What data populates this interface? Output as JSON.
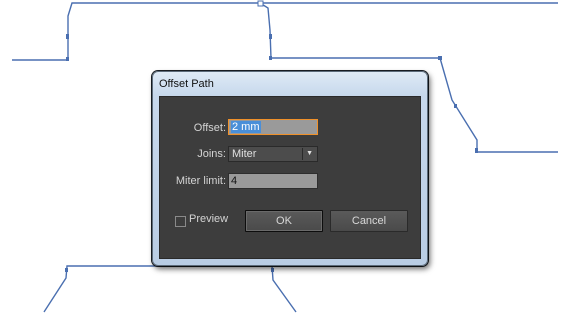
{
  "dialog": {
    "title": "Offset Path",
    "offset": {
      "label": "Offset:",
      "value": "2 mm"
    },
    "joins": {
      "label": "Joins:",
      "value": "Miter",
      "arrow_icon": "chevron-down-icon"
    },
    "miter_limit": {
      "label": "Miter limit:",
      "value": "4"
    },
    "preview": {
      "label": "Preview",
      "checked": false
    },
    "ok_label": "OK",
    "cancel_label": "Cancel"
  },
  "colors": {
    "path_stroke": "#4a6fb0",
    "dialog_bg": "#3d3d3d",
    "focus_border": "#f0912a",
    "selection": "#4a8fd8"
  }
}
